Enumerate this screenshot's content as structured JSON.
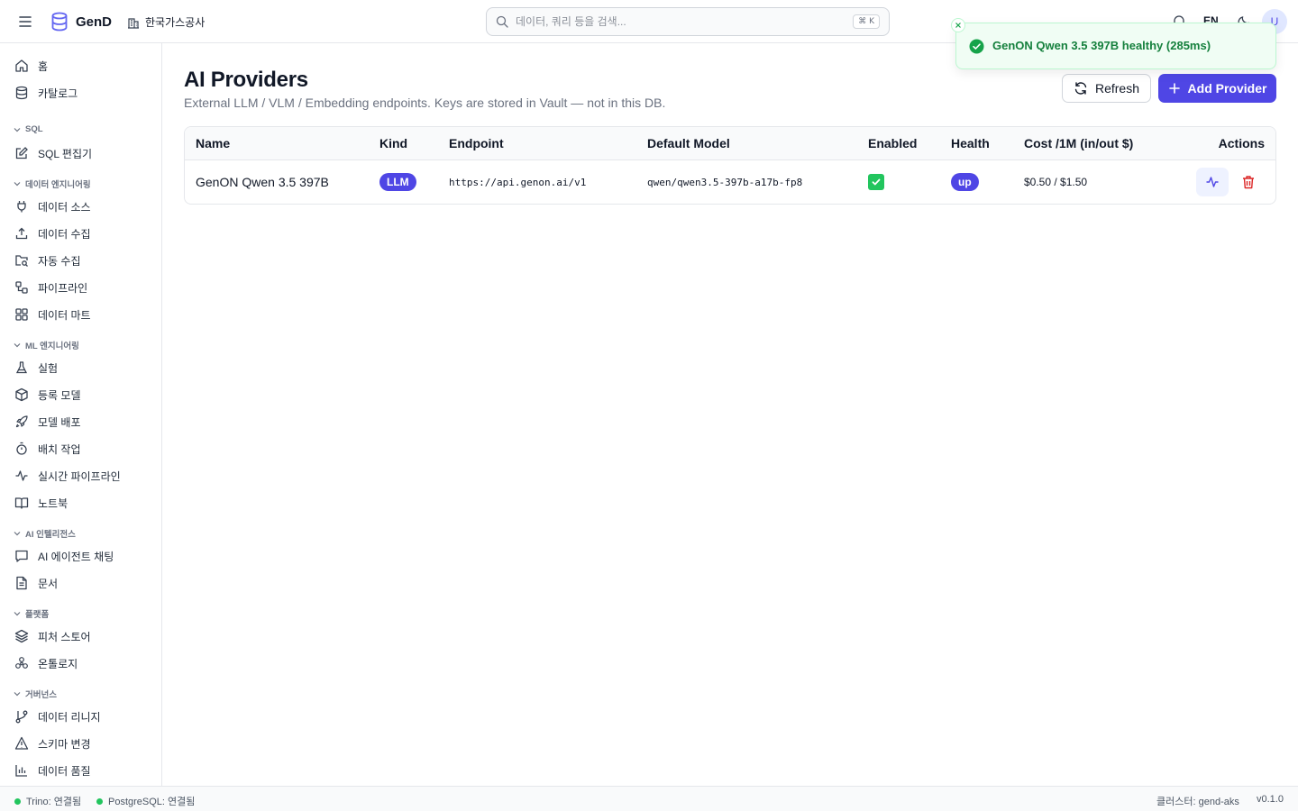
{
  "topbar": {
    "logo": "GenD",
    "org": "한국가스공사",
    "search_placeholder": "데이터, 쿼리 등을 검색...",
    "search_shortcut": "⌘ K",
    "lang": "EN",
    "avatar": "U"
  },
  "sidebar": {
    "top_items": [
      {
        "label": "홈",
        "icon": "home-icon"
      },
      {
        "label": "카탈로그",
        "icon": "database-icon"
      }
    ],
    "sections": [
      {
        "title": "SQL",
        "items": [
          {
            "label": "SQL 편집기",
            "icon": "edit-icon"
          }
        ]
      },
      {
        "title": "데이터 엔지니어링",
        "items": [
          {
            "label": "데이터 소스",
            "icon": "plug-icon"
          },
          {
            "label": "데이터 수집",
            "icon": "upload-icon"
          },
          {
            "label": "자동 수집",
            "icon": "folder-search-icon"
          },
          {
            "label": "파이프라인",
            "icon": "workflow-icon"
          },
          {
            "label": "데이터 마트",
            "icon": "grid-icon"
          }
        ]
      },
      {
        "title": "ML 엔지니어링",
        "items": [
          {
            "label": "실험",
            "icon": "flask-icon"
          },
          {
            "label": "등록 모델",
            "icon": "box-icon"
          },
          {
            "label": "모델 배포",
            "icon": "rocket-icon"
          },
          {
            "label": "배치 작업",
            "icon": "timer-icon"
          },
          {
            "label": "실시간 파이프라인",
            "icon": "activity-icon"
          },
          {
            "label": "노트북",
            "icon": "book-icon"
          }
        ]
      },
      {
        "title": "AI 인텔리전스",
        "items": [
          {
            "label": "AI 에이전트 채팅",
            "icon": "chat-icon"
          },
          {
            "label": "문서",
            "icon": "file-icon"
          }
        ]
      },
      {
        "title": "플랫폼",
        "items": [
          {
            "label": "피처 스토어",
            "icon": "layers-icon"
          },
          {
            "label": "온톨로지",
            "icon": "network-icon"
          }
        ]
      },
      {
        "title": "거버넌스",
        "items": [
          {
            "label": "데이터 리니지",
            "icon": "git-branch-icon"
          },
          {
            "label": "스키마 변경",
            "icon": "warning-icon"
          },
          {
            "label": "데이터 품질",
            "icon": "bar-chart-icon"
          }
        ]
      }
    ]
  },
  "page": {
    "title": "AI Providers",
    "subtitle": "External LLM / VLM / Embedding endpoints. Keys are stored in Vault — not in this DB.",
    "refresh_label": "Refresh",
    "add_label": "Add Provider"
  },
  "table": {
    "headers": [
      "Name",
      "Kind",
      "Endpoint",
      "Default Model",
      "Enabled",
      "Health",
      "Cost /1M (in/out $)",
      "Actions"
    ],
    "rows": [
      {
        "name": "GenON Qwen 3.5 397B",
        "kind": "LLM",
        "endpoint": "https://api.genon.ai/v1",
        "default_model": "qwen/qwen3.5-397b-a17b-fp8",
        "enabled": true,
        "health": "up",
        "cost": "$0.50 / $1.50"
      }
    ]
  },
  "toast": {
    "message": "GenON Qwen 3.5 397B healthy (285ms)"
  },
  "statusbar": {
    "trino": "Trino: 연결됨",
    "postgres": "PostgreSQL: 연결됨",
    "cluster": "클러스터: gend-aks",
    "version": "v0.1.0"
  },
  "colors": {
    "accent": "#4f46e5",
    "success": "#22c55e",
    "danger": "#dc2626"
  }
}
